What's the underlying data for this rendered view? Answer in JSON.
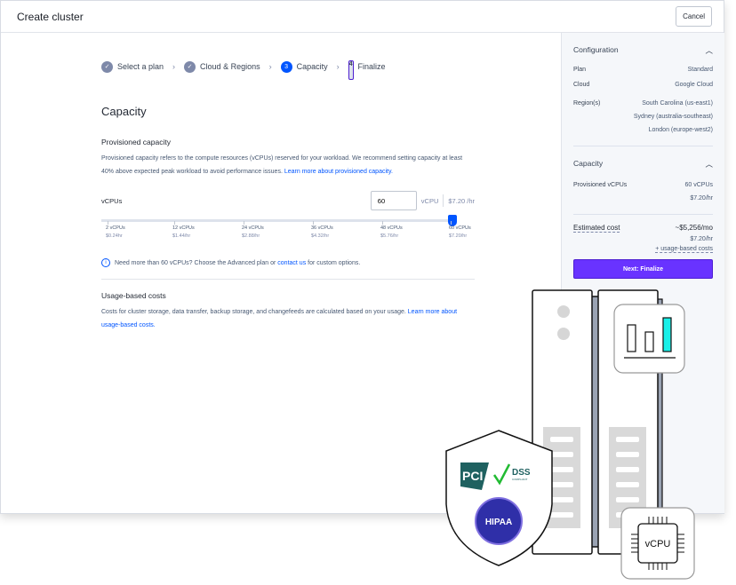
{
  "window": {
    "title": "Create cluster",
    "cancel": "Cancel"
  },
  "steps": [
    {
      "num": "1",
      "label": "Select a plan",
      "state": "done"
    },
    {
      "num": "2",
      "label": "Cloud & Regions",
      "state": "done"
    },
    {
      "num": "3",
      "label": "Capacity",
      "state": "current"
    },
    {
      "num": "4",
      "label": "Finalize",
      "state": "upcoming"
    }
  ],
  "main": {
    "title": "Capacity",
    "prov_title": "Provisioned capacity",
    "prov_desc": "Provisioned capacity refers to the compute resources (vCPUs) reserved for your workload. We recommend setting capacity at least 40% above expected peak workload to avoid performance issues. ",
    "prov_link": "Learn more about provisioned capacity.",
    "vcpus_label": "vCPUs",
    "vcpus_value": "60",
    "unit": "vCPU",
    "price": "$7.20 /hr",
    "slider": {
      "min": 2,
      "max": 60,
      "value": 60,
      "ticks": [
        {
          "label": "2 vCPUs",
          "price": "$0.24hr"
        },
        {
          "label": "12 vCPUs",
          "price": "$1.44/hr"
        },
        {
          "label": "24 vCPUs",
          "price": "$2.88/hr"
        },
        {
          "label": "36 vCPUs",
          "price": "$4.32/hr"
        },
        {
          "label": "48 vCPUs",
          "price": "$5.76/hr"
        },
        {
          "label": "60 vCPUs",
          "price": "$7.20/hr"
        }
      ]
    },
    "info_pre": "Need more than 60 vCPUs? Choose the Advanced plan or ",
    "info_link": "contact us",
    "info_post": " for custom options.",
    "usage_title": "Usage-based costs",
    "usage_desc": "Costs for cluster storage, data transfer, backup storage, and changefeeds are calculated based on your usage. ",
    "usage_link": "Learn more about usage-based costs."
  },
  "sidebar": {
    "config_title": "Configuration",
    "plan_k": "Plan",
    "plan_v": "Standard",
    "cloud_k": "Cloud",
    "cloud_v": "Google Cloud",
    "regions_k": "Region(s)",
    "regions": [
      "South Carolina (us-east1)",
      "Sydney (australia-southeast)",
      "London (europe-west2)"
    ],
    "capacity_title": "Capacity",
    "prov_k": "Provisioned vCPUs",
    "prov_v": "60 vCPUs",
    "prov_price": "$7.20/hr",
    "est_k": "Estimated cost",
    "est_v": "~$5,256/mo",
    "est_hr": "$7.20/hr",
    "est_usage": "+ usage-based costs",
    "next": "Next: Finalize"
  },
  "illustration": {
    "chip_label": "vCPU",
    "badge1": "PCI DSS COMPLIANT",
    "badge2": "HIPAA",
    "chart_accent": "#19f0e8"
  },
  "colors": {
    "primary": "#0055ff",
    "cta": "#6933ff"
  }
}
